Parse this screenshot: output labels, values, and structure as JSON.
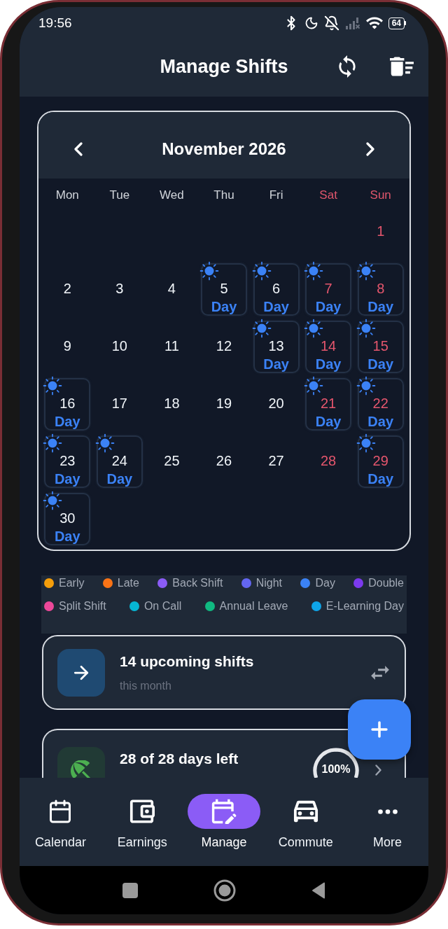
{
  "status_bar": {
    "time": "19:56",
    "battery": "64"
  },
  "header": {
    "title": "Manage Shifts"
  },
  "calendar": {
    "month": "November 2026",
    "weekdays": [
      {
        "label": "Mon",
        "weekend": false
      },
      {
        "label": "Tue",
        "weekend": false
      },
      {
        "label": "Wed",
        "weekend": false
      },
      {
        "label": "Thu",
        "weekend": false
      },
      {
        "label": "Fri",
        "weekend": false
      },
      {
        "label": "Sat",
        "weekend": true
      },
      {
        "label": "Sun",
        "weekend": true
      }
    ],
    "weeks": [
      [
        {
          "day": "1",
          "weekend": true
        }
      ],
      [
        {
          "day": "2",
          "weekend": false
        },
        {
          "day": "3",
          "weekend": false
        },
        {
          "day": "4",
          "weekend": false
        },
        {
          "day": "5",
          "weekend": false,
          "shift": "Day"
        },
        {
          "day": "6",
          "weekend": false,
          "shift": "Day"
        },
        {
          "day": "7",
          "weekend": true,
          "shift": "Day"
        },
        {
          "day": "8",
          "weekend": true,
          "shift": "Day"
        }
      ],
      [
        {
          "day": "9",
          "weekend": false
        },
        {
          "day": "10",
          "weekend": false
        },
        {
          "day": "11",
          "weekend": false
        },
        {
          "day": "12",
          "weekend": false
        },
        {
          "day": "13",
          "weekend": false,
          "shift": "Day"
        },
        {
          "day": "14",
          "weekend": true,
          "shift": "Day"
        },
        {
          "day": "15",
          "weekend": true,
          "shift": "Day"
        }
      ],
      [
        {
          "day": "16",
          "weekend": false,
          "shift": "Day"
        },
        {
          "day": "17",
          "weekend": false
        },
        {
          "day": "18",
          "weekend": false
        },
        {
          "day": "19",
          "weekend": false
        },
        {
          "day": "20",
          "weekend": false
        },
        {
          "day": "21",
          "weekend": true,
          "shift": "Day"
        },
        {
          "day": "22",
          "weekend": true,
          "shift": "Day"
        }
      ],
      [
        {
          "day": "23",
          "weekend": false,
          "shift": "Day"
        },
        {
          "day": "24",
          "weekend": false,
          "shift": "Day"
        },
        {
          "day": "25",
          "weekend": false
        },
        {
          "day": "26",
          "weekend": false
        },
        {
          "day": "27",
          "weekend": false
        },
        {
          "day": "28",
          "weekend": true
        },
        {
          "day": "29",
          "weekend": true,
          "shift": "Day"
        }
      ],
      [
        {
          "day": "30",
          "weekend": false,
          "shift": "Day"
        }
      ]
    ]
  },
  "legend": [
    {
      "label": "Early",
      "color": "#f59e0b"
    },
    {
      "label": "Late",
      "color": "#f97316"
    },
    {
      "label": "Back Shift",
      "color": "#8b5cf6"
    },
    {
      "label": "Night",
      "color": "#6366f1"
    },
    {
      "label": "Day",
      "color": "#3b82f6"
    },
    {
      "label": "Double",
      "color": "#7c3aed"
    },
    {
      "label": "Split Shift",
      "color": "#ec4899"
    },
    {
      "label": "On Call",
      "color": "#06b6d4"
    },
    {
      "label": "Annual Leave",
      "color": "#10b981"
    },
    {
      "label": "E-Learning Day",
      "color": "#0ea5e9"
    }
  ],
  "summary_cards": [
    {
      "kind": "upcoming",
      "title": "14 upcoming shifts",
      "subtitle": "this month"
    },
    {
      "kind": "leave",
      "title": "28 of 28 days left",
      "ring_label": "100%",
      "level": 1
    }
  ],
  "nav": [
    {
      "label": "Calendar",
      "selected": false
    },
    {
      "label": "Earnings",
      "selected": false
    },
    {
      "label": "Manage",
      "selected": true
    },
    {
      "label": "Commute",
      "selected": false
    },
    {
      "label": "More",
      "selected": false
    }
  ]
}
